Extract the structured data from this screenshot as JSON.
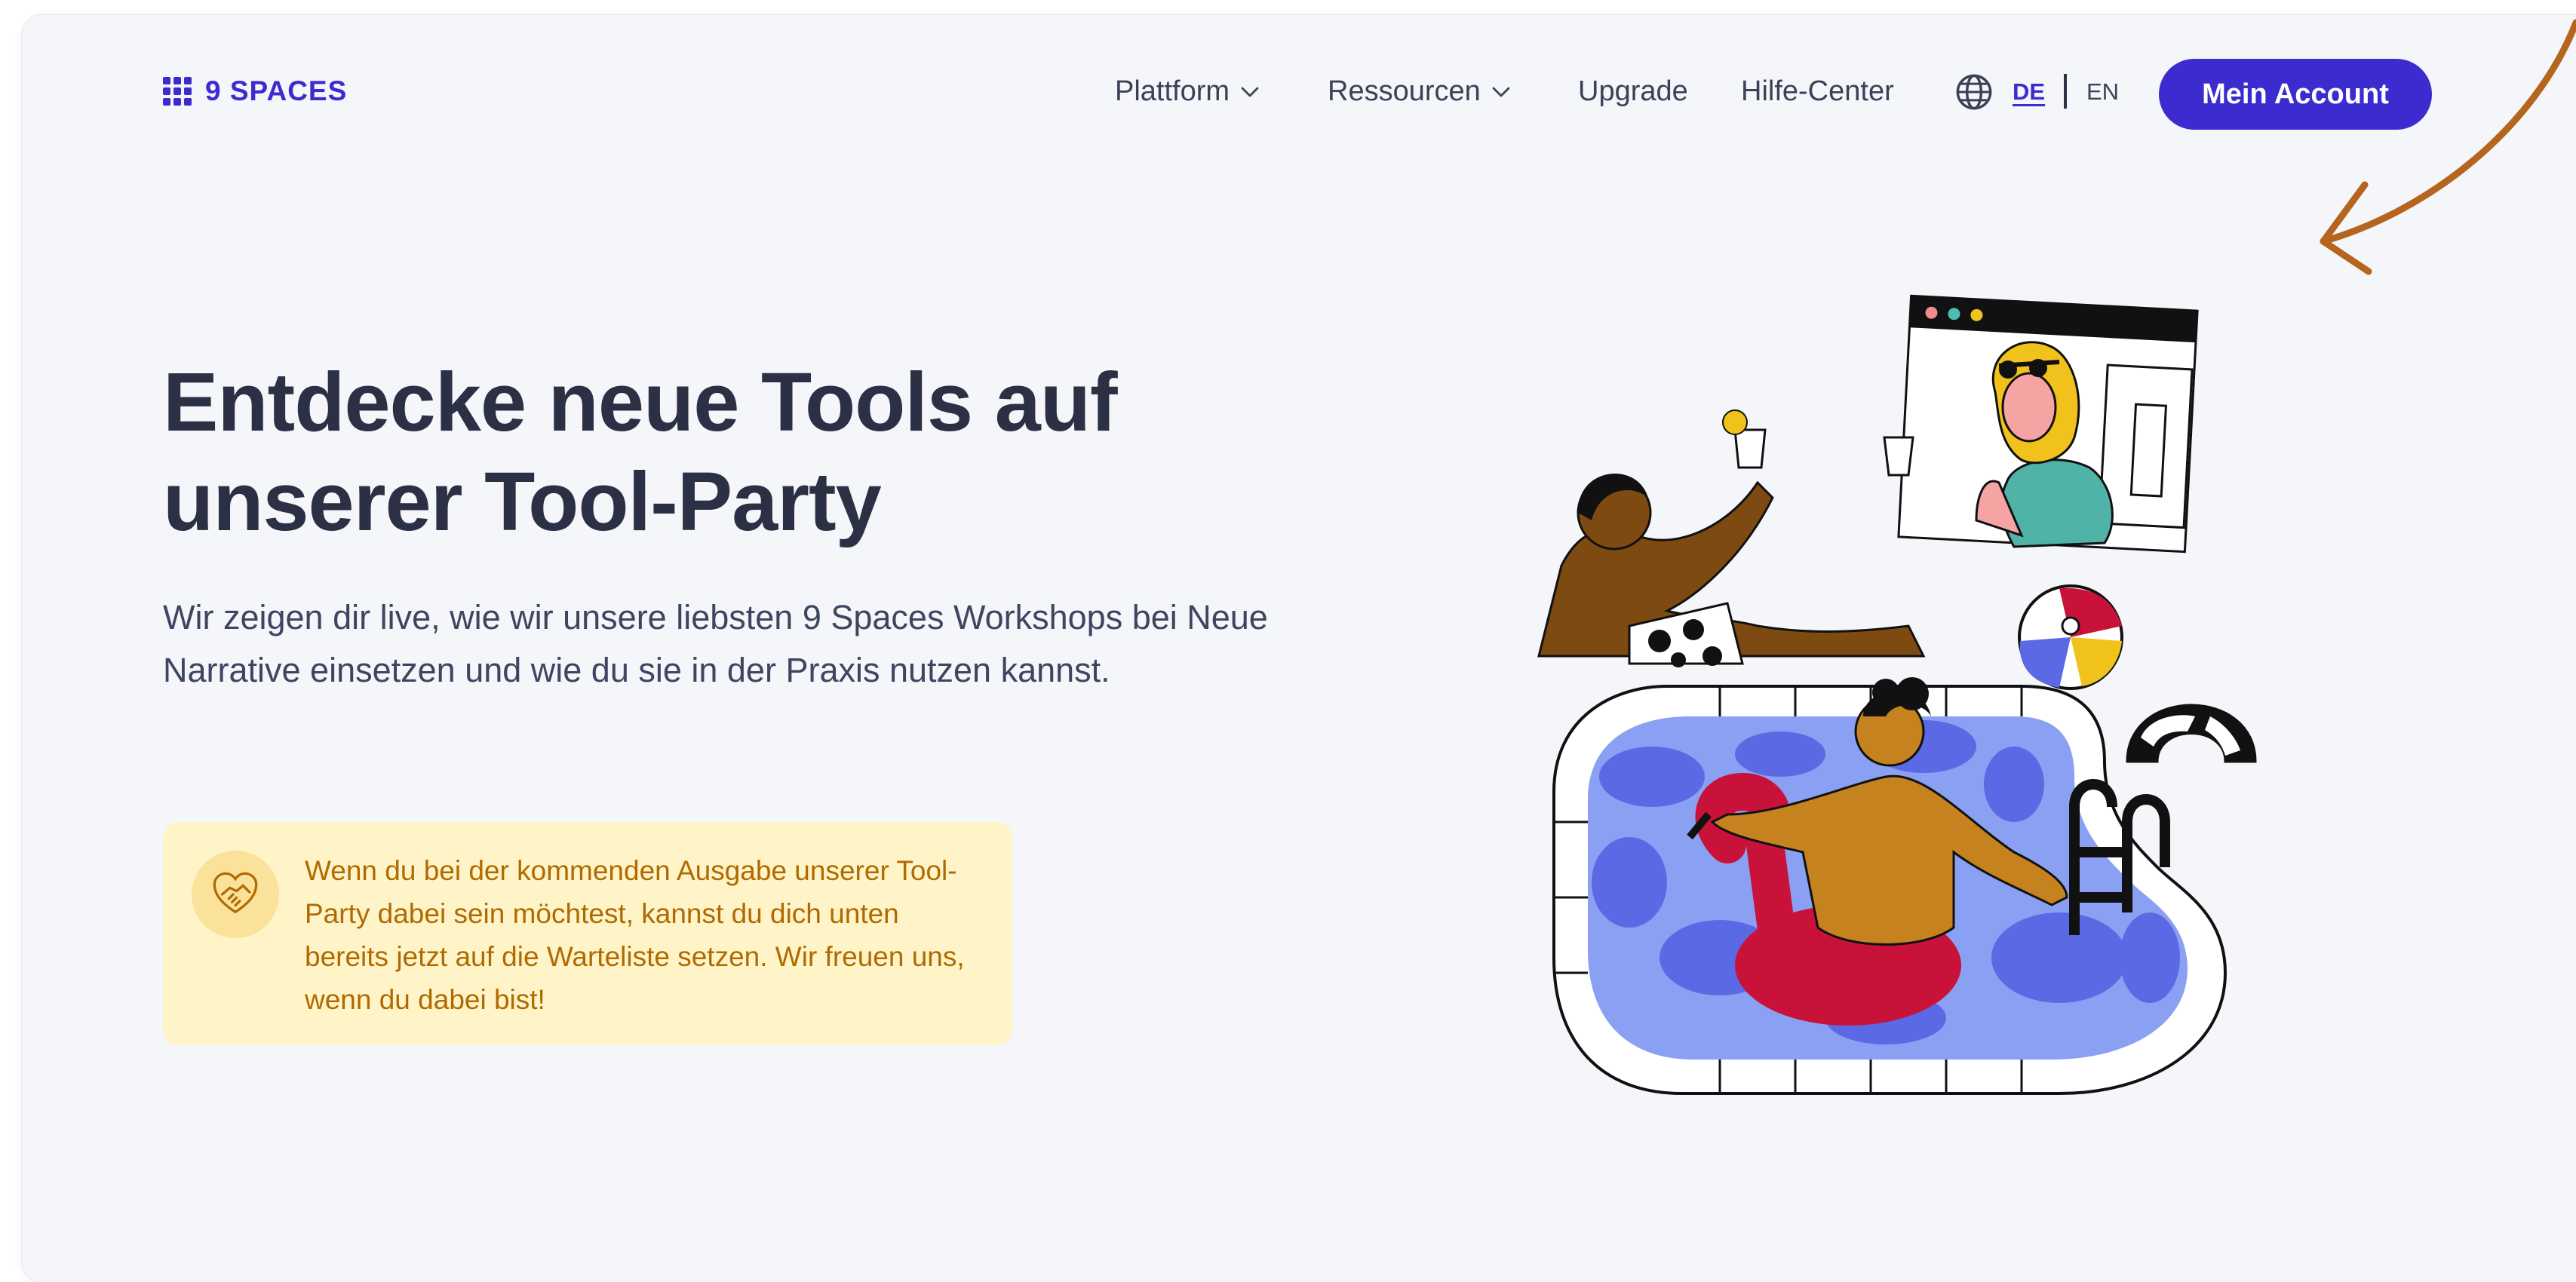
{
  "brand": {
    "name": "9 SPACES",
    "color": "#3c2ccf"
  },
  "nav": {
    "items": [
      {
        "label": "Plattform",
        "has_dropdown": true
      },
      {
        "label": "Ressourcen",
        "has_dropdown": true
      },
      {
        "label": "Upgrade",
        "has_dropdown": false
      },
      {
        "label": "Hilfe-Center",
        "has_dropdown": false
      }
    ],
    "language": {
      "icon": "globe-icon",
      "active": "DE",
      "other": "EN"
    },
    "account_button": "Mein Account"
  },
  "hero": {
    "title_line1": "Entdecke neue Tools auf",
    "title_line2": "unserer Tool-Party",
    "subtitle": "Wir zeigen dir live, wie wir unsere liebsten 9 Spaces Workshops bei Neue Narrative einsetzen und wie du sie in der Praxis nutzen kannst.",
    "notice": {
      "icon": "handshake-heart-icon",
      "text": "Wenn du bei der kommenden Ausgabe unserer Tool-Party dabei sein möchtest, kannst du dich unten bereits jetzt auf die Warteliste setzen. Wir freuen uns, wenn du dabei bist!"
    },
    "illustration": "pool-party-illustration"
  },
  "annotation": {
    "icon": "hand-drawn-arrow-icon",
    "color": "#b5651d"
  },
  "colors": {
    "accent": "#3c2ccf",
    "background": "#f5f6fa",
    "notice_bg": "#fff4c7",
    "notice_text": "#b06a00"
  }
}
